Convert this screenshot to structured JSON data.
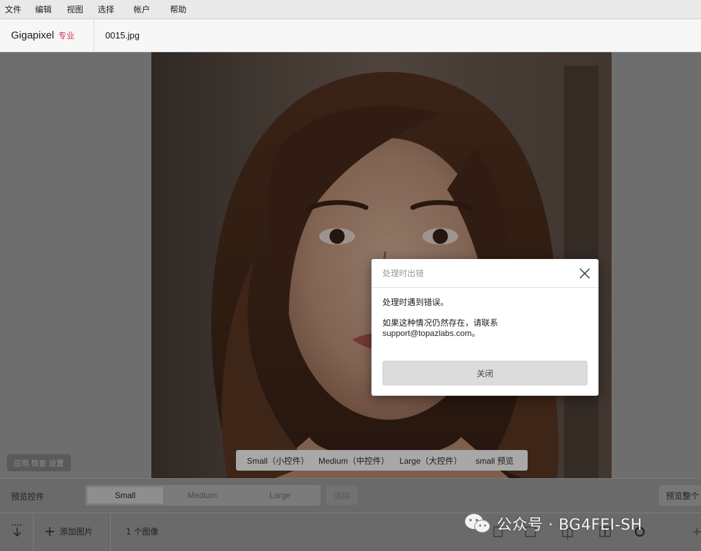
{
  "menu": {
    "items": [
      {
        "label": "文件"
      },
      {
        "label": "编辑"
      },
      {
        "label": "视图"
      },
      {
        "label": "选择"
      },
      {
        "label": "帐户"
      },
      {
        "label": "帮助"
      }
    ]
  },
  "header": {
    "app_name": "Gigapixel",
    "tier": "专业",
    "filename": "0015.jpg"
  },
  "workspace": {
    "settings_button": "应用 恢复 设置",
    "size_popup": {
      "options": [
        "Small（小控件）",
        "Medium（中控件）",
        "Large（大控件）",
        "small 预览"
      ]
    }
  },
  "controls": {
    "preview_label": "预览控件",
    "segments": [
      {
        "label": "Small",
        "active": true
      },
      {
        "label": "Medium",
        "active": false
      },
      {
        "label": "Large",
        "active": false
      }
    ],
    "clear_label": "清除",
    "preview_all_label": "预览整个"
  },
  "bottom": {
    "add_image_label": "添加图片",
    "image_count": "1 个图像"
  },
  "watermark": {
    "text": "公众号 · BG4FEI-SH"
  },
  "dialog": {
    "title": "处理时出错",
    "message_line1": "处理时遇到错误。",
    "message_line2": "如果这种情况仍然存在，请联系",
    "message_email": "support@topazlabs.com。",
    "button_label": "关闭"
  },
  "colors": {
    "accent": "#d2334c",
    "menubar_bg": "#e9e9e9",
    "dialog_button_bg": "#dcdcdc"
  }
}
